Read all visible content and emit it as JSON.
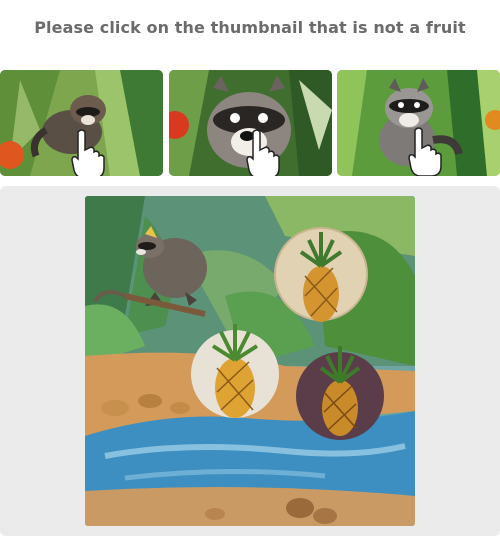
{
  "prompt": {
    "text": "Please click on the thumbnail that is not a fruit"
  },
  "thumbnails": [
    {
      "subject": "raccoon",
      "icon": "hand-pointer-icon"
    },
    {
      "subject": "raccoon",
      "icon": "hand-pointer-icon"
    },
    {
      "subject": "raccoon",
      "icon": "hand-pointer-icon"
    }
  ],
  "scene": {
    "items": [
      "raccoon",
      "pineapple",
      "pineapple",
      "pineapple"
    ]
  },
  "colors": {
    "prompt_text": "#6b6b6b",
    "panel_bg": "#ebebeb",
    "jungle_green": "#4e8f3c",
    "water_blue": "#3c8fc0",
    "sand": "#d49a5a"
  }
}
